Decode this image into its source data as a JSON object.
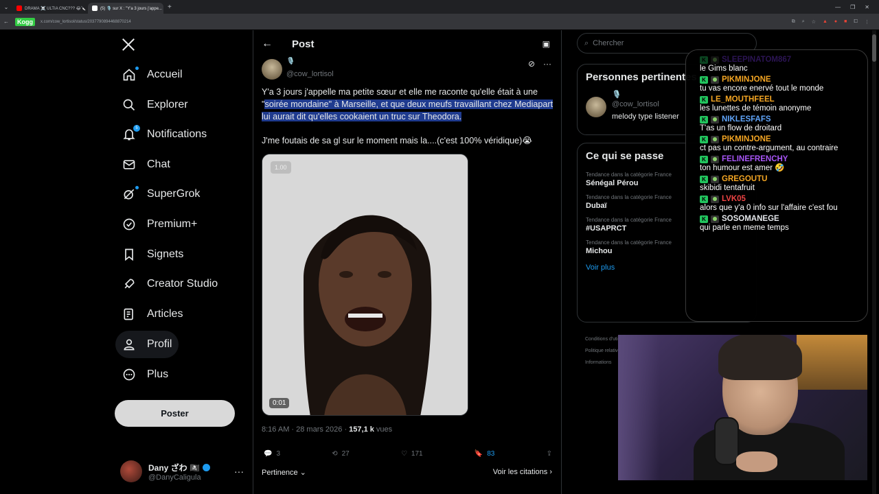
{
  "browser": {
    "tabs": [
      {
        "label": "DRAMA ☠️ ULTIA CNC??? 😂🔪",
        "color": "#ff0000"
      },
      {
        "label": "(5) 🎙️ sur X : \"Y'a 3 jours j'appe...",
        "color": "#ffffff"
      }
    ],
    "url": "x.com/cow_lortisol/status/2037790894468870214",
    "kogg_logo": "Kogg"
  },
  "nav": {
    "items": [
      {
        "label": "Accueil",
        "icon": "home-icon"
      },
      {
        "label": "Explorer",
        "icon": "search-icon"
      },
      {
        "label": "Notifications",
        "icon": "bell-icon"
      },
      {
        "label": "Chat",
        "icon": "mail-icon"
      },
      {
        "label": "SuperGrok",
        "icon": "grok-icon"
      },
      {
        "label": "Premium+",
        "icon": "verified-icon"
      },
      {
        "label": "Signets",
        "icon": "bookmark-icon"
      },
      {
        "label": "Creator Studio",
        "icon": "rocket-icon"
      },
      {
        "label": "Articles",
        "icon": "article-icon"
      },
      {
        "label": "Profil",
        "icon": "person-icon"
      },
      {
        "label": "Plus",
        "icon": "more-circle-icon"
      }
    ],
    "notif_count": "5",
    "post_button": "Poster",
    "account": {
      "display_name": "Dany ざわ 🏴‍☠️",
      "handle": "@DanyCaligula"
    }
  },
  "post": {
    "header_title": "Post",
    "author_handle": "@cow_lortisol",
    "author_emoji": "🎙️",
    "text_plain_1": "Y'a 3 jours j'appelle ma petite sœur et elle me raconte qu'elle était à une \"",
    "text_hl": "soirée mondaine\" à Marseille, et que deux meufs travaillant chez Mediapart lui aurait dit qu'elles cookaient un truc sur Theodora.",
    "text_2": "J'me foutais de sa gl sur le moment mais la....(c'est 100% véridique)😭",
    "video_speed": "1.00",
    "video_time": "0:01",
    "time": "8:16 AM · 28 mars 2026 · ",
    "views_count": "157,1 k",
    "views_label": " vues",
    "replies": "3",
    "reposts": "27",
    "likes": "171",
    "bookmarks": "83",
    "sort_label": "Pertinence",
    "quotes_label": "Voir les citations"
  },
  "right": {
    "search_placeholder": "Chercher",
    "people_title": "Personnes pertinentes",
    "person": {
      "emoji": "🎙️",
      "handle": "@cow_lortisol",
      "bio": "melody type listener"
    },
    "trends_title": "Ce qui se passe",
    "trends": [
      {
        "category": "Tendance dans la catégorie France",
        "name": "Sénégal Pérou"
      },
      {
        "category": "Tendance dans la catégorie France",
        "name": "Dubaï"
      },
      {
        "category": "Tendance dans la catégorie France",
        "name": "#USAPRCT"
      },
      {
        "category": "Tendance dans la catégorie France",
        "name": "Michou"
      }
    ],
    "see_more": "Voir plus",
    "footer": [
      "Conditions d'utilisation",
      "Politique relative",
      "Informations"
    ]
  },
  "chat": {
    "messages": [
      {
        "user": "SLEEPINATOM867",
        "color": "#7c3aed",
        "text": "le Gims blanc",
        "faded": true
      },
      {
        "user": "PIKMINJONE",
        "color": "#f5a623",
        "text": "tu vas encore enervé tout le monde",
        "faded": false
      },
      {
        "user": "LE_MOUTHFEEL",
        "color": "#f5a623",
        "text": "les lunettes de témoin anonyme",
        "faded": false
      },
      {
        "user": "NIKLESFAFS",
        "color": "#60a5fa",
        "text": "T'as un flow de droitard",
        "faded": false
      },
      {
        "user": "PIKMINJONE",
        "color": "#f5a623",
        "text": "ct pas un contre-argument, au contraire",
        "faded": false
      },
      {
        "user": "FELINEFRENCHY",
        "color": "#a855f7",
        "text": "ton humour est amer 🤣",
        "faded": false
      },
      {
        "user": "GREGOUTU",
        "color": "#f5a623",
        "text": "skibidi tentafruit",
        "faded": false
      },
      {
        "user": "LVK05",
        "color": "#ef4444",
        "text": "alors que y'a 0 info sur l'affaire c'est fou",
        "faded": false
      },
      {
        "user": "SOSOMANEGE",
        "color": "#e5e7eb",
        "text": "qui parle en meme temps",
        "faded": false
      }
    ]
  },
  "colors": {
    "accent": "#1d9bf0",
    "highlight": "#1f3b8f",
    "chat_badge": "#22c55e"
  }
}
